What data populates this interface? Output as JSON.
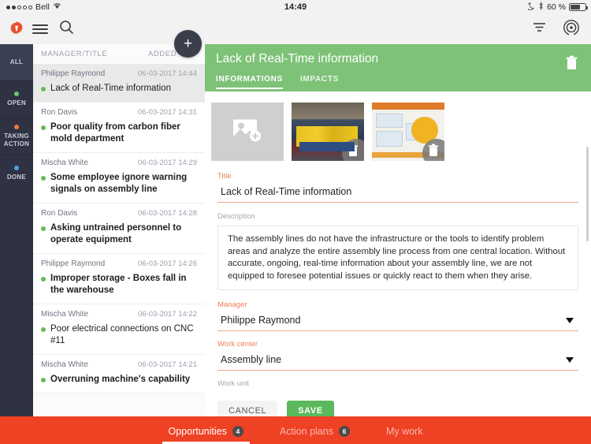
{
  "status_bar": {
    "carrier": "Bell",
    "wifi_icon": "wifi-icon",
    "time": "14:49",
    "dnd_icon": "moon-icon",
    "bluetooth_icon": "bluetooth-icon",
    "battery_text": "60 %"
  },
  "app_bar": {
    "logo_icon": "gear-logo-icon",
    "menu_icon": "hamburger-menu-icon",
    "search_icon": "search-icon",
    "filter_icon": "filter-icon",
    "broadcast_icon": "broadcast-icon"
  },
  "rail": {
    "items": [
      {
        "label": "ALL",
        "dot_color": "",
        "active": true
      },
      {
        "label": "OPEN",
        "dot_color": "#6dc36a",
        "active": false
      },
      {
        "label": "TAKING ACTION",
        "dot_color": "#ee7d3a",
        "active": false
      },
      {
        "label": "DONE",
        "dot_color": "#4aa3dd",
        "active": false
      }
    ]
  },
  "list": {
    "headers": {
      "manager_title": "MANAGER/TITLE",
      "added": "ADDED"
    },
    "add_button_icon": "plus-icon",
    "rows": [
      {
        "manager": "Philippe Raymond",
        "date": "06-03-2017 14:44",
        "title": "Lack of Real-Time information",
        "dot": "#6dc36a",
        "selected": true,
        "bold": false
      },
      {
        "manager": "Ron Davis",
        "date": "06-03-2017 14:31",
        "title": "Poor quality from carbon fiber mold department",
        "dot": "#6dc36a",
        "selected": false,
        "bold": true
      },
      {
        "manager": "Mischa White",
        "date": "06-03-2017 14:29",
        "title": "Some employee ignore warning signals on assembly line",
        "dot": "#6dc36a",
        "selected": false,
        "bold": true
      },
      {
        "manager": "Ron Davis",
        "date": "06-03-2017 14:28",
        "title": "Asking untrained personnel to operate equipment",
        "dot": "#6dc36a",
        "selected": false,
        "bold": true
      },
      {
        "manager": "Philippe Raymond",
        "date": "06-03-2017 14:26",
        "title": "Improper storage - Boxes fall in the warehouse",
        "dot": "#6dc36a",
        "selected": false,
        "bold": true
      },
      {
        "manager": "Mischa White",
        "date": "06-03-2017 14:22",
        "title": "Poor electrical connections on CNC #11",
        "dot": "#6dc36a",
        "selected": false,
        "bold": false
      },
      {
        "manager": "Mischa White",
        "date": "06-03-2017 14:21",
        "title": "Overruning machine's capability",
        "dot": "#6dc36a",
        "selected": false,
        "bold": true
      }
    ]
  },
  "detail": {
    "title": "Lack of Real-Time information",
    "delete_icon": "trash-icon",
    "tabs": [
      {
        "label": "INFORMATIONS",
        "active": true
      },
      {
        "label": "IMPACTS",
        "active": false
      }
    ],
    "thumbnails": [
      {
        "type": "add-photo-placeholder",
        "icon": "add-photo-icon",
        "delete_icon": ""
      },
      {
        "type": "photo-factory",
        "icon": "",
        "delete_icon": "trash-icon"
      },
      {
        "type": "photo-poster",
        "icon": "",
        "delete_icon": "trash-icon"
      }
    ],
    "fields": {
      "title_label": "Title",
      "title_value": "Lack of Real-Time information",
      "description_label": "Description",
      "description_value": "The assembly lines do not have the infrastructure or the tools to identify problem areas and analyze the entire assembly line process from one central location. Without accurate, ongoing, real-time information about your assembly line, we are not equipped to foresee potential issues or quickly react to them when they arise.",
      "manager_label": "Manager",
      "manager_value": "Philippe Raymond",
      "work_center_label": "Work center",
      "work_center_value": "Assembly line",
      "work_unit_label": "Work unit",
      "work_unit_value": ""
    },
    "cancel_label": "CANCEL",
    "save_label": "SAVE"
  },
  "bottom_bar": {
    "tabs": [
      {
        "label": "Opportunities",
        "badge": "4",
        "active": true
      },
      {
        "label": "Action plans",
        "badge": "6",
        "active": false
      },
      {
        "label": "My work",
        "badge": "",
        "active": false
      }
    ]
  },
  "colors": {
    "header_green": "#7ec278",
    "save_green": "#5cb85c",
    "bottom_orange": "#ef4123",
    "rail_dark": "#2f3242",
    "accent_label": "#ef8055"
  }
}
